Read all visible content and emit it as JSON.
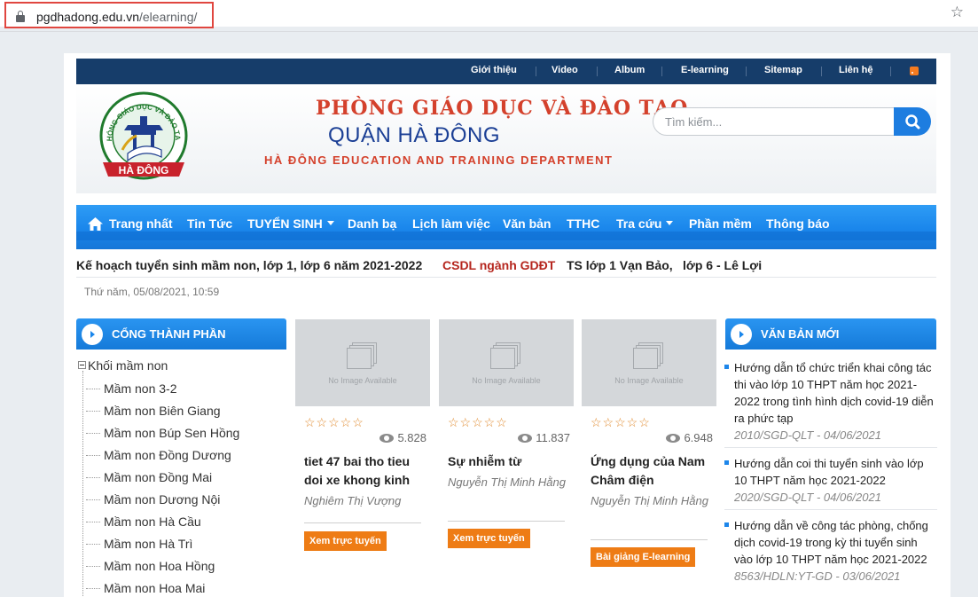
{
  "browser": {
    "url_host": "pgdhadong.edu.vn",
    "url_path": "/elearning/"
  },
  "topnav": {
    "items": [
      "Giới thiệu",
      "Video",
      "Album",
      "E-learning",
      "Sitemap",
      "Liên hệ"
    ]
  },
  "header": {
    "title_line1": "PHÒNG GIÁO DỤC VÀ ĐÀO TẠO",
    "title_line2": "QUẬN HÀ ĐÔNG",
    "title_line3": "HÀ ĐÔNG EDUCATION AND TRAINING DEPARTMENT",
    "logo_ring_text": "PHÒNG GIÁO DỤC VÀ ĐÀO TẠO",
    "logo_ribbon_text": "HÀ ĐÔNG"
  },
  "search": {
    "placeholder": "Tìm kiếm..."
  },
  "mainnav": {
    "items": [
      "Trang nhất",
      "Tin Tức",
      "TUYỂN SINH",
      "Danh bạ",
      "Lịch làm việc",
      "Văn bản",
      "TTHC",
      "Tra cứu",
      "Phần mềm",
      "Thông báo"
    ]
  },
  "ticker": {
    "item1": "Kế hoạch tuyển sinh mầm non, lớp 1, lớp 6 năm 2021-2022",
    "item2": "CSDL ngành GDĐT",
    "item3": "TS lớp 1 Vạn Bảo,",
    "item4": "lớp 6 - Lê Lợi"
  },
  "date": "Thứ năm, 05/08/2021, 10:59",
  "left_sidebar": {
    "header": "CỔNG THÀNH PHẦN",
    "root": "Khối mầm non",
    "items": [
      "Mầm non 3-2",
      "Mầm non Biên Giang",
      "Mầm non Búp Sen Hồng",
      "Mầm non Đồng Dương",
      "Mầm non Đồng Mai",
      "Mầm non Dương Nội",
      "Mầm non Hà Cầu",
      "Mầm non Hà Trì",
      "Mầm non Hoa Hồng",
      "Mầm non Hoa Mai"
    ]
  },
  "cards": [
    {
      "no_image": "No Image Available",
      "stars": "☆☆☆☆☆",
      "views": "5.828",
      "title": "tiet 47 bai tho tieu doi xe khong kinh",
      "author": "Nghiêm Thị Vượng",
      "button": "Xem trực tuyến"
    },
    {
      "no_image": "No Image Available",
      "stars": "☆☆☆☆☆",
      "views": "11.837",
      "title": "Sự nhiễm từ",
      "author": "Nguyễn Thị Minh Hằng",
      "button": "Xem trực tuyến"
    },
    {
      "no_image": "No Image Available",
      "stars": "☆☆☆☆☆",
      "views": "6.948",
      "title": "Ứng dụng của Nam Châm điện",
      "author": "Nguyễn Thị Minh Hằng",
      "button": "Bài giảng E-learning"
    }
  ],
  "right_sidebar": {
    "header": "VĂN BẢN MỚI",
    "docs": [
      {
        "title": "Hướng dẫn tổ chức triển khai công tác thi vào lớp 10 THPT năm học 2021-2022 trong tình hình dịch covid-19 diễn ra phức tạp",
        "meta": "2010/SGD-QLT - 04/06/2021"
      },
      {
        "title": "Hướng dẫn coi thi tuyển sinh vào lớp 10 THPT năm học 2021-2022",
        "meta": "2020/SGD-QLT - 04/06/2021"
      },
      {
        "title": "Hướng dẫn về công tác phòng, chống dịch covid-19 trong kỳ thi tuyển sinh vào lớp 10 THPT năm học 2021-2022",
        "meta": "8563/HDLN:YT-GD - 03/06/2021"
      }
    ]
  },
  "colors": {
    "topnav_bg": "#163d6a",
    "mainnav_blue": "#1a86eb",
    "title_red": "#d4412c",
    "title_blue": "#1b3f95",
    "button_orange": "#ee7c15"
  }
}
